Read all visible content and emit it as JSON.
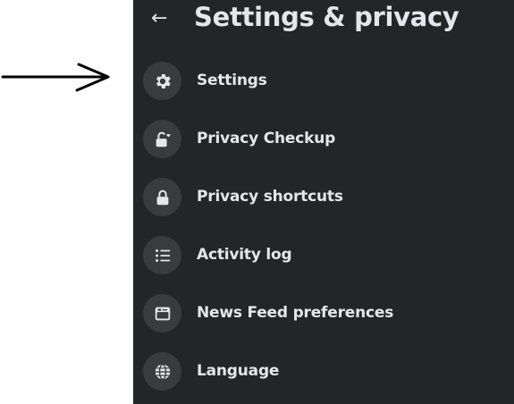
{
  "header": {
    "back_glyph": "←",
    "title": "Settings & privacy"
  },
  "menu": {
    "items": [
      {
        "label": "Settings",
        "icon": "gear-icon"
      },
      {
        "label": "Privacy Checkup",
        "icon": "lock-heart-icon"
      },
      {
        "label": "Privacy shortcuts",
        "icon": "lock-icon"
      },
      {
        "label": "Activity log",
        "icon": "list-icon"
      },
      {
        "label": "News Feed preferences",
        "icon": "news-feed-icon"
      },
      {
        "label": "Language",
        "icon": "globe-icon"
      }
    ]
  },
  "colors": {
    "panel_background": "#242526",
    "icon_circle": "#3a3b3c",
    "text": "#e4e6eb",
    "annotation": "#000000"
  }
}
